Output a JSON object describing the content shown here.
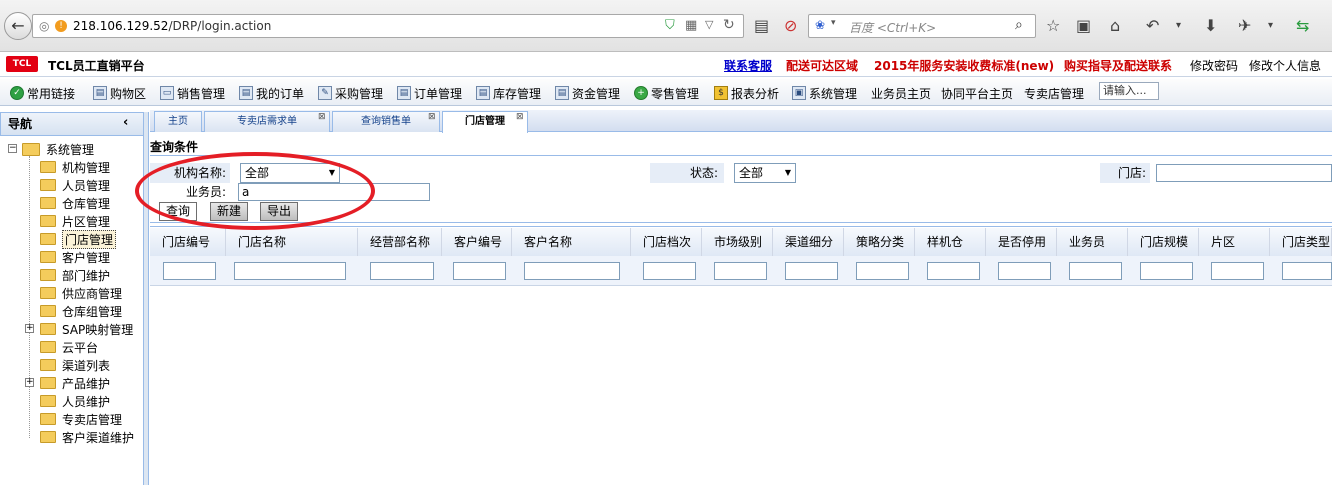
{
  "browser": {
    "url_host": "218.106.129.52",
    "url_path": "/DRP/login.action",
    "search_placeholder": "百度 <Ctrl+K>"
  },
  "app": {
    "logo": "TCL",
    "title": "TCL员工直销平台",
    "header_links": [
      {
        "label": "联系客服",
        "color": "#0000cc"
      },
      {
        "label": "配送可达区域",
        "color": "#cc0000"
      },
      {
        "label": "2015年服务安装收费标准(new)",
        "color": "#cc0000"
      },
      {
        "label": "购买指导及配送联系",
        "color": "#cc0000"
      },
      {
        "label": "修改密码",
        "color": "#000000"
      },
      {
        "label": "修改个人信息",
        "color": "#000000"
      }
    ]
  },
  "toolbar": {
    "items": [
      "常用链接",
      "购物区",
      "销售管理",
      "我的订单",
      "采购管理",
      "订单管理",
      "库存管理",
      "资金管理",
      "零售管理",
      "报表分析",
      "系统管理",
      "业务员主页",
      "协同平台主页",
      "专卖店管理"
    ],
    "search_placeholder": "请输入..."
  },
  "nav": {
    "title": "导航",
    "root": "系统管理",
    "items": [
      "机构管理",
      "人员管理",
      "仓库管理",
      "片区管理",
      "门店管理",
      "客户管理",
      "部门维护",
      "供应商管理",
      "仓库组管理",
      "SAP映射管理",
      "云平台",
      "渠道列表",
      "产品维护",
      "人员维护",
      "专卖店管理",
      "客户渠道维护"
    ]
  },
  "tabs": [
    "主页",
    "专卖店需求单",
    "查询销售单",
    "门店管理"
  ],
  "query": {
    "title": "查询条件",
    "org_label": "机构名称:",
    "org_value": "全部",
    "status_label": "状态:",
    "status_value": "全部",
    "store_label": "门店:",
    "salesman_label": "业务员:",
    "salesman_value": "a",
    "btn_query": "查询",
    "btn_new": "新建",
    "btn_export": "导出"
  },
  "grid": {
    "columns": [
      "门店编号",
      "门店名称",
      "经营部名称",
      "客户编号",
      "客户名称",
      "门店档次",
      "市场级别",
      "渠道细分",
      "策略分类",
      "样机仓",
      "是否停用",
      "业务员",
      "门店规模",
      "片区",
      "门店类型"
    ]
  },
  "colors": {
    "annotation": "#e41e26",
    "accent_border": "#99bbe8"
  }
}
